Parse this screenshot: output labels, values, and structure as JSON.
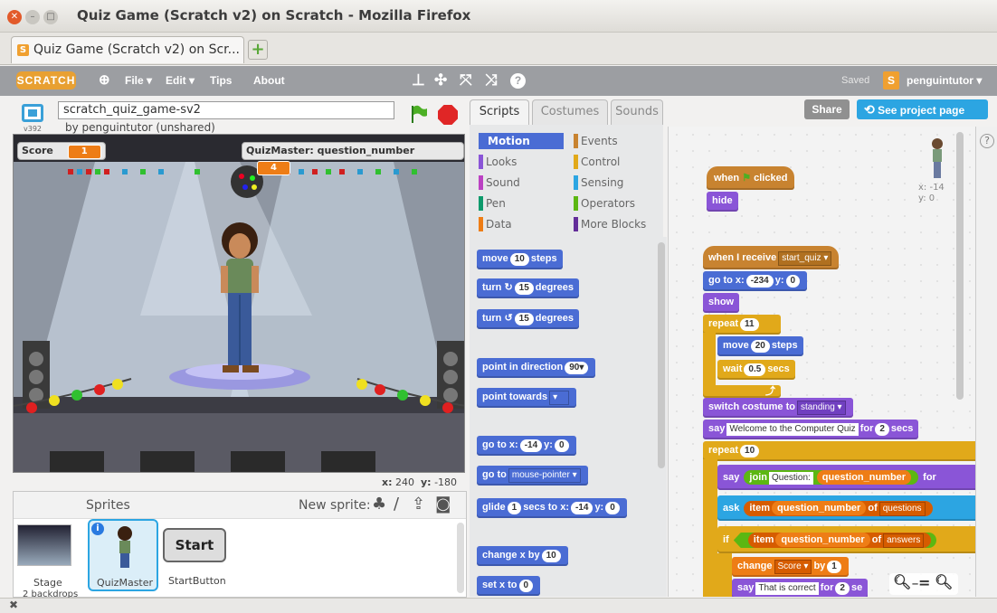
{
  "window": {
    "title": "Quiz Game (Scratch v2) on Scratch - Mozilla Firefox"
  },
  "browser": {
    "tab_label": "Quiz Game (Scratch v2) on Scr..."
  },
  "menubar": {
    "logo": "SCRATCH",
    "file": "File ▾",
    "edit": "Edit ▾",
    "tips": "Tips",
    "about": "About",
    "saved": "Saved",
    "user_badge": "S",
    "username": "penguintutor ▾"
  },
  "project": {
    "version": "v392",
    "name": "scratch_quiz_game-sv2",
    "by": "by penguintutor (unshared)"
  },
  "stage": {
    "monitors": [
      {
        "label": "Score",
        "value": "1"
      },
      {
        "label": "QuizMaster: question_number",
        "value": "4"
      }
    ],
    "coords_x_label": "x:",
    "coords_x": "240",
    "coords_y_label": "y:",
    "coords_y": "-180"
  },
  "sprites": {
    "header": "Sprites",
    "new_sprite": "New sprite:",
    "stage_label": "Stage",
    "stage_sub": "2 backdrops",
    "items": [
      {
        "name": "QuizMaster"
      },
      {
        "name": "StartButton",
        "thumb_text": "Start"
      }
    ]
  },
  "editor": {
    "tabs": [
      "Scripts",
      "Costumes",
      "Sounds"
    ],
    "share": "Share",
    "see_project": "See project page",
    "sprite_x": "x: -14",
    "sprite_y": "y: 0"
  },
  "categories": [
    {
      "label": "Motion",
      "color": "#4a6cd4"
    },
    {
      "label": "Events",
      "color": "#c88330"
    },
    {
      "label": "Looks",
      "color": "#8a55d7"
    },
    {
      "label": "Control",
      "color": "#e1a91a"
    },
    {
      "label": "Sound",
      "color": "#bb42c3"
    },
    {
      "label": "Sensing",
      "color": "#2ca5e2"
    },
    {
      "label": "Pen",
      "color": "#0e9a6c"
    },
    {
      "label": "Operators",
      "color": "#5cb712"
    },
    {
      "label": "Data",
      "color": "#ee7d16"
    },
    {
      "label": "More Blocks",
      "color": "#632d99"
    }
  ],
  "palette": {
    "move": "move",
    "move_n": "10",
    "steps": "steps",
    "turn": "turn",
    "turn_n": "15",
    "degrees": "degrees",
    "point_dir": "point in direction",
    "point_dir_n": "90▾",
    "point_towards": "point towards",
    "goto_xy": "go to x:",
    "goto_x": "-14",
    "y_lbl": "y:",
    "goto_y": "0",
    "goto": "go to",
    "goto_target": "mouse-pointer ▾",
    "glide": "glide",
    "glide_n": "1",
    "glide_secs": "secs to x:",
    "glide_x": "-14",
    "glide_y": "0",
    "change_x": "change x by",
    "change_x_n": "10",
    "set_x": "set x to",
    "set_x_n": "0"
  },
  "script": {
    "when": "when",
    "clicked": "clicked",
    "hide": "hide",
    "when_receive": "when I receive",
    "receive_msg": "start_quiz ▾",
    "goto_xy": "go to x:",
    "goto_x": "-234",
    "y_lbl": "y:",
    "goto_y": "0",
    "show": "show",
    "repeat": "repeat",
    "repeat_n": "11",
    "move": "move",
    "move_n": "20",
    "steps": "steps",
    "wait": "wait",
    "wait_n": "0.5",
    "secs": "secs",
    "switch": "switch costume to",
    "costume": "standing ▾",
    "say": "say",
    "say_text": "Welcome to the Computer Quiz",
    "for": "for",
    "say_n": "2",
    "say_secs": "secs",
    "repeat2_n": "10",
    "join": "join",
    "question_lbl": "Question:",
    "qnum": "question_number",
    "for_trunc": "for",
    "ask": "ask",
    "item": "item",
    "of": "of",
    "questions": "questions",
    "if": "if",
    "answers": "answers",
    "change": "change",
    "score_var": "Score ▾",
    "by": "by",
    "change_n": "1",
    "correct": "That is correct",
    "correct_n": "2",
    "se": "se"
  },
  "zoom": {
    "out": "−",
    "reset": "=",
    "in": "+"
  }
}
